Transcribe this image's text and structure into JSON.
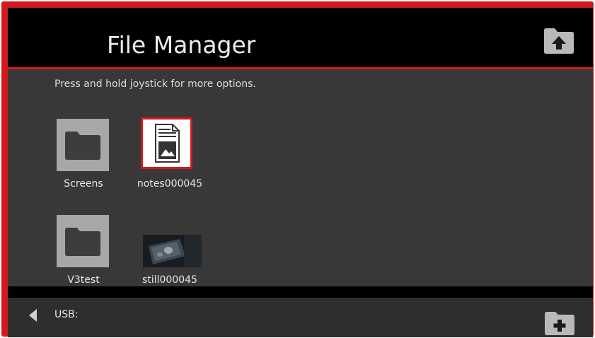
{
  "app": {
    "title": "File Manager",
    "accent_color": "#d4191e",
    "upload_icon": "folder-upload-icon"
  },
  "content": {
    "hint": "Press and hold joystick for more options.",
    "items": [
      {
        "label": "Screens",
        "type": "folder",
        "icon": "folder-icon",
        "selected": false
      },
      {
        "label": "notes000045",
        "type": "image-document",
        "icon": "image-document-icon",
        "selected": true
      },
      {
        "label": "V3test",
        "type": "folder",
        "icon": "folder-icon",
        "selected": false
      },
      {
        "label": "still000045",
        "type": "image",
        "icon": "image-thumbnail",
        "selected": false
      }
    ]
  },
  "footer": {
    "location": "USB:",
    "back_icon": "triangle-left-icon",
    "add_icon": "folder-add-icon"
  }
}
